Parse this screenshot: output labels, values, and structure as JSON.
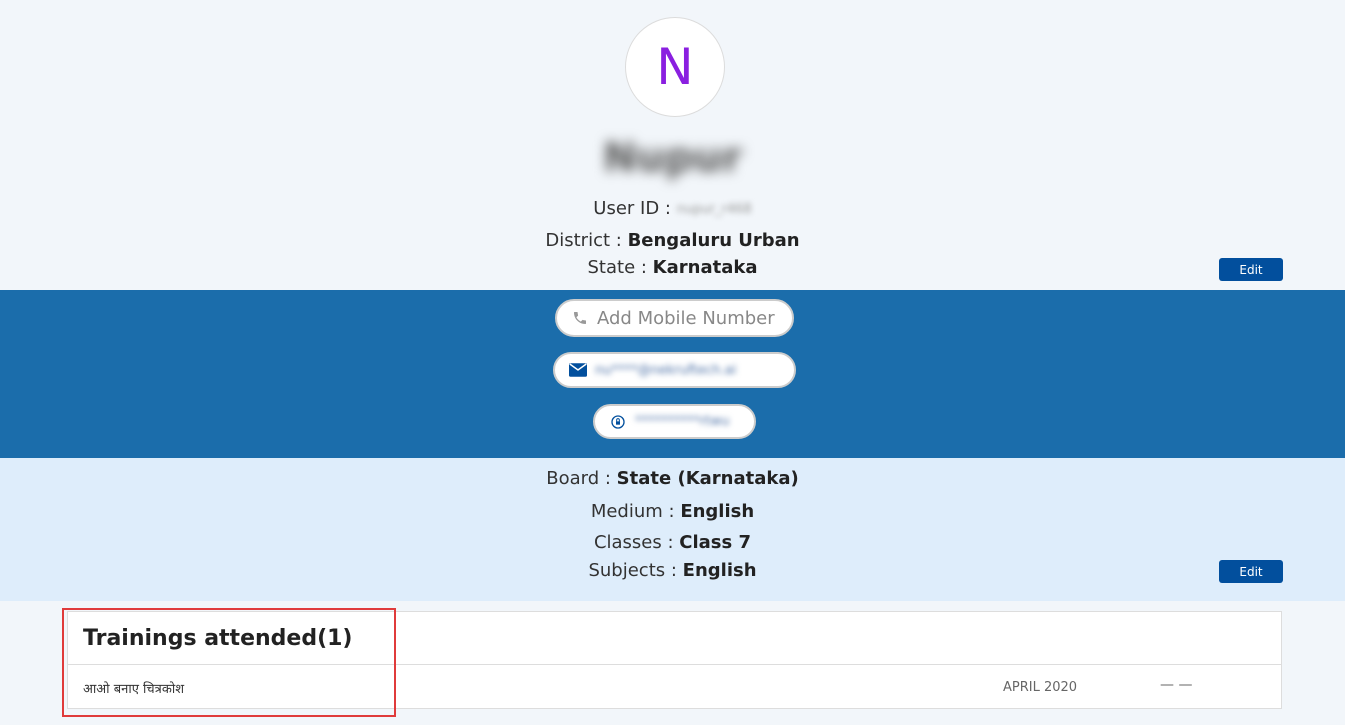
{
  "profile": {
    "avatar_letter": "N",
    "name": "Nupur",
    "user_id_label": "User ID :",
    "user_id_value": "nupur_r468",
    "district_label": "District :",
    "district_value": "Bengaluru Urban",
    "state_label": "State :",
    "state_value": "Karnataka",
    "edit_label": "Edit"
  },
  "contact": {
    "mobile_placeholder": "Add Mobile Number",
    "email_value": "nu****@nekruftech.ai",
    "recovery_value": "**********rtwu"
  },
  "preferences": {
    "board_label": "Board :",
    "board_value": "State (Karnataka)",
    "medium_label": "Medium :",
    "medium_value": "English",
    "classes_label": "Classes :",
    "classes_value": "Class 7",
    "subjects_label": "Subjects :",
    "subjects_value": "English",
    "edit_label": "Edit"
  },
  "trainings": {
    "title": "Trainings attended(1)",
    "items": [
      {
        "name": "आओ बनाए चित्रकोश",
        "date": "APRIL 2020",
        "status": "— —"
      }
    ]
  },
  "colors": {
    "avatar_letter": "#8a1fe0",
    "contact_band": "#1b6dab",
    "prefs_band": "#deedfb",
    "edit_button": "#024f9d",
    "highlight": "#e03b3b"
  },
  "icons": {
    "mobile": "phone-icon",
    "email": "envelope-icon",
    "recovery": "lock-reset-icon"
  }
}
